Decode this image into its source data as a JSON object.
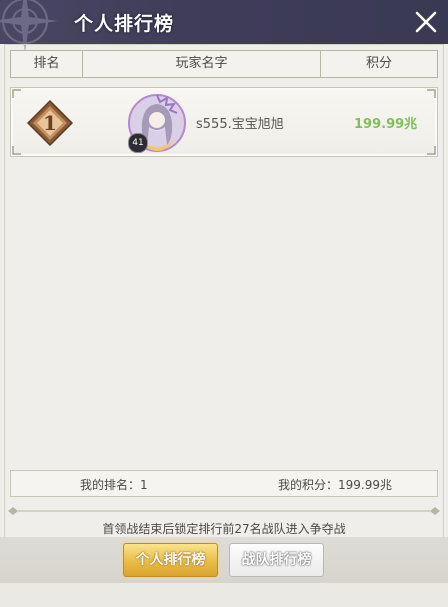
{
  "window": {
    "title": "个人排行榜",
    "close_icon": "close-icon"
  },
  "table": {
    "headers": [
      "排名",
      "玩家名字",
      "积分"
    ],
    "rows": [
      {
        "rank": "1",
        "level": "41",
        "player_name": "s555.宝宝旭旭",
        "score": "199.99兆"
      }
    ]
  },
  "my_info": {
    "rank_label": "我的排名：1",
    "score_label": "我的积分：199.99兆"
  },
  "notice": "首领战结束后锁定排行前27名战队进入争夺战",
  "tabs": [
    {
      "label": "个人排行榜",
      "active": true
    },
    {
      "label": "战队排行榜",
      "active": false
    }
  ],
  "colors": {
    "title_bar": "#3f3d59",
    "score_green": "#7fbf5d",
    "active_tab": "#e8b943",
    "rank_badge": "#a9764a"
  }
}
